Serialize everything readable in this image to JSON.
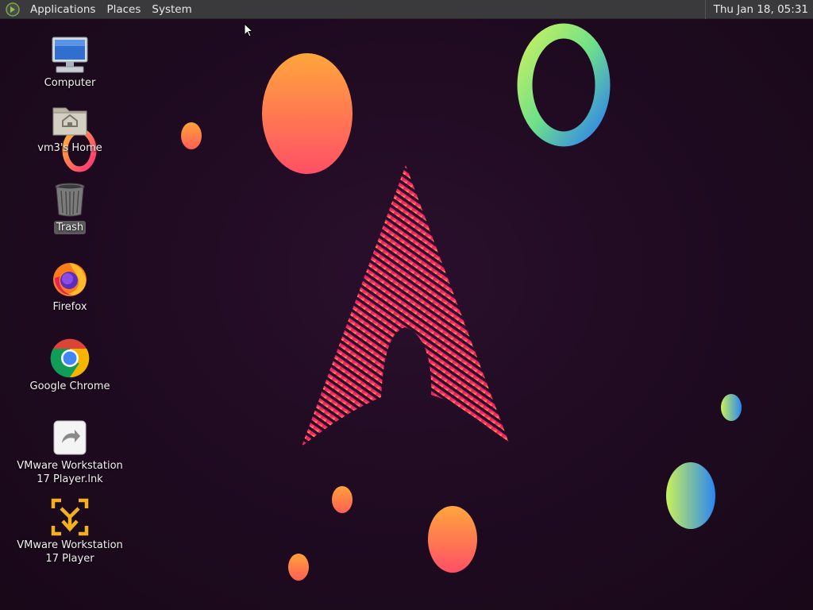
{
  "panel": {
    "menus": [
      "Applications",
      "Places",
      "System"
    ],
    "clock": "Thu Jan 18, 05:31"
  },
  "desktop_icons": [
    {
      "label": "Computer",
      "icon": "computer-icon"
    },
    {
      "label": "vm3's Home",
      "icon": "home-folder-icon"
    },
    {
      "label": "Trash",
      "icon": "trash-icon",
      "selected": true
    },
    {
      "label": "Firefox",
      "icon": "firefox-icon"
    },
    {
      "label": "Google Chrome",
      "icon": "chrome-icon"
    },
    {
      "label": "VMware Workstation 17 Player.lnk",
      "icon": "shortcut-file-icon"
    },
    {
      "label": "VMware Workstation 17 Player",
      "icon": "vmware-icon"
    }
  ],
  "wallpaper": {
    "theme": "arch-linux-logo-with-gradient-bubbles"
  },
  "colors": {
    "panel": "#3a3a3c",
    "background": "#200b22",
    "accent_pink": "#e0135f"
  }
}
